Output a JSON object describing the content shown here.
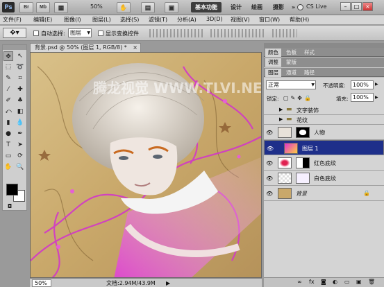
{
  "titlebar": {
    "logo": "Ps",
    "btn_br": "Br",
    "btn_mb": "Mb",
    "zoom": "50%",
    "workspaces": [
      "基本功能",
      "设计",
      "绘画",
      "摄影"
    ],
    "more": "»",
    "cslive": "CS Live",
    "win_min": "–",
    "win_max": "□",
    "win_close": "×"
  },
  "menubar": {
    "items": [
      "文件(F)",
      "编辑(E)",
      "图像(I)",
      "图层(L)",
      "选择(S)",
      "滤镜(T)",
      "分析(A)",
      "3D(D)",
      "视图(V)",
      "窗口(W)",
      "帮助(H)"
    ]
  },
  "options": {
    "auto_select_label": "自动选择:",
    "auto_select_value": "图层",
    "show_transform_label": "显示变换控件"
  },
  "document": {
    "tab_title": "背景.psd @ 50% (图层 1, RGB/8) *",
    "close": "×",
    "watermark": "腾龙视觉 WWW.TLVI.NET",
    "zoom_field": "50%",
    "doc_info": "文档:2.94M/43.9M"
  },
  "panels": {
    "top_tabs": [
      "颜色",
      "色板",
      "样式"
    ],
    "mid_tabs": [
      "调整",
      "蒙版"
    ],
    "layer_tabs": [
      "图层",
      "通道",
      "路径"
    ],
    "blend_mode": "正常",
    "opacity_label": "不透明度:",
    "opacity_value": "100%",
    "lock_label": "锁定:",
    "fill_label": "填充:",
    "fill_value": "100%",
    "layers": [
      {
        "name": "文字装饰",
        "type": "group",
        "visible": false
      },
      {
        "name": "花纹",
        "type": "group",
        "visible": false
      },
      {
        "name": "人物",
        "type": "layer",
        "visible": true
      },
      {
        "name": "图层 1",
        "type": "layer",
        "visible": true,
        "selected": true
      },
      {
        "name": "红色底纹",
        "type": "layer",
        "visible": true
      },
      {
        "name": "白色底纹",
        "type": "layer",
        "visible": true
      },
      {
        "name": "背景",
        "type": "layer",
        "visible": true,
        "locked": true
      }
    ],
    "bottom_icons": [
      "link-icon",
      "fx-icon",
      "mask-icon",
      "adjustment-icon",
      "folder-icon",
      "new-layer-icon",
      "trash-icon"
    ]
  },
  "colors": {
    "selection": "#1e2f8a",
    "foreground": "#000000",
    "background": "#ffffff"
  }
}
